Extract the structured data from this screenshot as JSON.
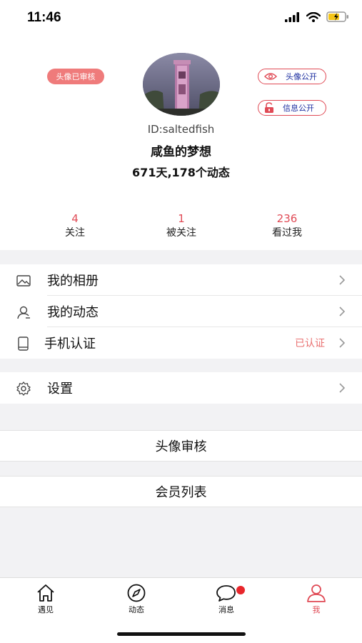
{
  "status_bar": {
    "time": "11:46"
  },
  "profile": {
    "avatar_audit_badge": "头像已审核",
    "avatar_public_label": "头像公开",
    "info_public_label": "信息公开",
    "user_id": "ID:saltedfish",
    "nickname": "咸鱼的梦想",
    "summary": "671天,178个动态"
  },
  "stats": [
    {
      "value": "4",
      "label": "关注"
    },
    {
      "value": "1",
      "label": "被关注"
    },
    {
      "value": "236",
      "label": "看过我"
    }
  ],
  "menu": {
    "album": {
      "label": "我的相册",
      "icon": "photo-icon"
    },
    "moments": {
      "label": "我的动态",
      "icon": "user-icon"
    },
    "phone": {
      "label": "手机认证",
      "value": "已认证",
      "icon": "phone-icon"
    },
    "settings": {
      "label": "设置",
      "icon": "gear-icon"
    }
  },
  "admin": {
    "avatar_review": "头像审核",
    "member_list": "会员列表"
  },
  "tabs": [
    {
      "label": "遇见",
      "icon": "home-icon"
    },
    {
      "label": "动态",
      "icon": "compass-icon"
    },
    {
      "label": "消息",
      "icon": "chat-icon"
    },
    {
      "label": "我",
      "icon": "person-icon"
    }
  ],
  "colors": {
    "accent": "#e04a55",
    "badge": "#e8262b",
    "verified": "#e97070"
  }
}
